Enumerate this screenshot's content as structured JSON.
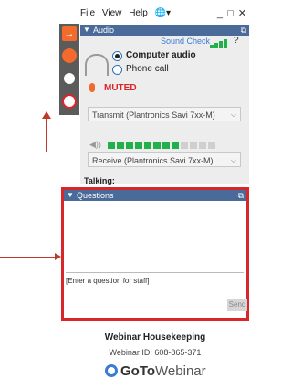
{
  "menu": {
    "file": "File",
    "view": "View",
    "help": "Help",
    "globe": "🌐▾"
  },
  "window_controls": "_ □ ✕",
  "audio": {
    "title": "Audio",
    "sound_check": "Sound Check",
    "help": "?",
    "options": [
      {
        "label": "Computer audio",
        "selected": true
      },
      {
        "label": "Phone call",
        "selected": false
      }
    ],
    "muted": "MUTED",
    "transmit": "Transmit (Plantronics Savi 7xx-M)",
    "receive": "Receive (Plantronics Savi 7xx-M)",
    "volume_level": 0.67
  },
  "talking": "Talking:",
  "questions": {
    "title": "Questions",
    "placeholder": "[Enter a question for staff]",
    "send": "Send"
  },
  "footer": {
    "title": "Webinar Housekeeping",
    "webinar_id": "Webinar ID: 608-865-371",
    "brand_goto": "GoTo",
    "brand_webinar": "Webinar"
  },
  "colors": {
    "accent": "#4a6a9a",
    "highlight": "#d9262b",
    "toolbar_orange": "#f26b2d",
    "meter_green": "#22b04b"
  }
}
